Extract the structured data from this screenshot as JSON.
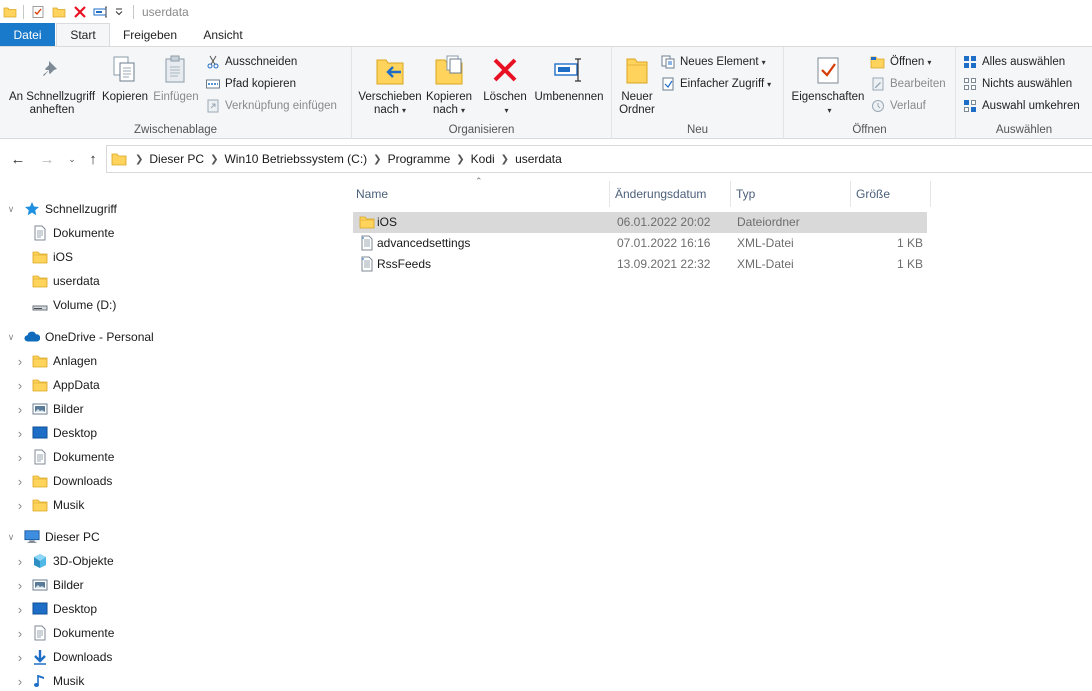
{
  "window": {
    "title": "userdata"
  },
  "quick_access_toolbar": {
    "items": [
      "folder-icon",
      "properties-check-icon",
      "new-folder-icon",
      "delete-icon",
      "rename-icon",
      "customize-dropdown-icon"
    ]
  },
  "ribbon_tabs": [
    {
      "label": "Datei",
      "state": "file"
    },
    {
      "label": "Start",
      "state": "active"
    },
    {
      "label": "Freigeben",
      "state": "normal"
    },
    {
      "label": "Ansicht",
      "state": "normal"
    }
  ],
  "ribbon": {
    "clipboard": {
      "label": "Zwischenablage",
      "pin": "An Schnellzugriff\nanheften",
      "copy": "Kopieren",
      "paste": "Einfügen",
      "cut": "Ausschneiden",
      "copy_path": "Pfad kopieren",
      "paste_shortcut": "Verknüpfung einfügen"
    },
    "organize": {
      "label": "Organisieren",
      "move_to": "Verschieben\nnach",
      "copy_to": "Kopieren\nnach",
      "delete": "Löschen",
      "rename": "Umbenennen"
    },
    "new": {
      "label": "Neu",
      "new_folder": "Neuer\nOrdner",
      "new_item": "Neues Element",
      "easy_access": "Einfacher Zugriff"
    },
    "open": {
      "label": "Öffnen",
      "properties": "Eigenschaften",
      "open": "Öffnen",
      "edit": "Bearbeiten",
      "history": "Verlauf"
    },
    "select": {
      "label": "Auswählen",
      "select_all": "Alles auswählen",
      "select_none": "Nichts auswählen",
      "invert": "Auswahl umkehren"
    }
  },
  "address_bar": {
    "breadcrumbs": [
      "Dieser PC",
      "Win10 Betriebssystem (C:)",
      "Programme",
      "Kodi",
      "userdata"
    ]
  },
  "nav_pane": {
    "items": [
      {
        "label": "Schnellzugriff",
        "icon": "star-icon",
        "level": 0,
        "expander": "expanded"
      },
      {
        "label": "Dokumente",
        "icon": "document-icon",
        "level": 1,
        "expander": "none"
      },
      {
        "label": "iOS",
        "icon": "folder-icon",
        "level": 1,
        "expander": "none"
      },
      {
        "label": "userdata",
        "icon": "folder-icon",
        "level": 1,
        "expander": "none"
      },
      {
        "label": "Volume (D:)",
        "icon": "drive-icon",
        "level": 1,
        "expander": "none"
      },
      {
        "label": "OneDrive - Personal",
        "icon": "cloud-icon",
        "level": 0,
        "expander": "expanded"
      },
      {
        "label": "Anlagen",
        "icon": "folder-icon",
        "level": 1,
        "expander": "collapsed"
      },
      {
        "label": "AppData",
        "icon": "folder-icon",
        "level": 1,
        "expander": "collapsed"
      },
      {
        "label": "Bilder",
        "icon": "pictures-icon",
        "level": 1,
        "expander": "collapsed"
      },
      {
        "label": "Desktop",
        "icon": "desktop-icon",
        "level": 1,
        "expander": "collapsed"
      },
      {
        "label": "Dokumente",
        "icon": "document-icon",
        "level": 1,
        "expander": "collapsed"
      },
      {
        "label": "Downloads",
        "icon": "folder-icon",
        "level": 1,
        "expander": "collapsed"
      },
      {
        "label": "Musik",
        "icon": "folder-icon",
        "level": 1,
        "expander": "collapsed"
      },
      {
        "label": "Dieser PC",
        "icon": "computer-icon",
        "level": 0,
        "expander": "expanded"
      },
      {
        "label": "3D-Objekte",
        "icon": "cube-icon",
        "level": 1,
        "expander": "collapsed"
      },
      {
        "label": "Bilder",
        "icon": "pictures-icon",
        "level": 1,
        "expander": "collapsed"
      },
      {
        "label": "Desktop",
        "icon": "desktop-icon",
        "level": 1,
        "expander": "collapsed"
      },
      {
        "label": "Dokumente",
        "icon": "document-icon",
        "level": 1,
        "expander": "collapsed"
      },
      {
        "label": "Downloads",
        "icon": "download-icon",
        "level": 1,
        "expander": "collapsed"
      },
      {
        "label": "Musik",
        "icon": "music-icon",
        "level": 1,
        "expander": "collapsed"
      }
    ]
  },
  "file_list": {
    "columns": [
      "Name",
      "Änderungsdatum",
      "Typ",
      "Größe"
    ],
    "rows": [
      {
        "name": "iOS",
        "date": "06.01.2022 20:02",
        "type": "Dateiordner",
        "size": "",
        "icon": "folder-icon",
        "selected": true
      },
      {
        "name": "advancedsettings",
        "date": "07.01.2022 16:16",
        "type": "XML-Datei",
        "size": "1 KB",
        "icon": "xml-file-icon",
        "selected": false
      },
      {
        "name": "RssFeeds",
        "date": "13.09.2021 22:32",
        "type": "XML-Datei",
        "size": "1 KB",
        "icon": "xml-file-icon",
        "selected": false
      }
    ]
  },
  "colors": {
    "file_tab": "#1979ca",
    "folder": "#ffd35c",
    "delete_red": "#e81123",
    "selection": "#d9d9d9",
    "column_header_text": "#4c607a"
  }
}
